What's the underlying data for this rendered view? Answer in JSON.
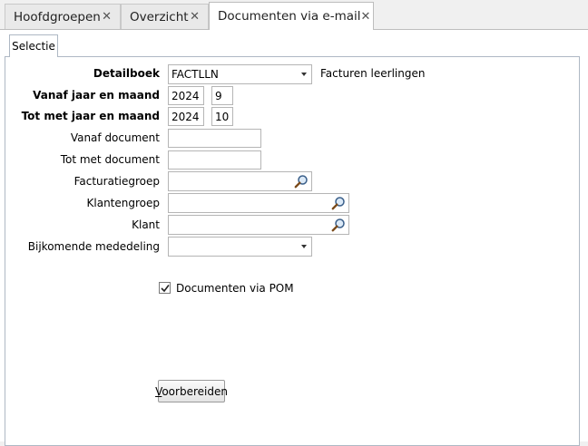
{
  "tabs": [
    {
      "label": "Hoofdgroepen",
      "close": "✕"
    },
    {
      "label": "Overzicht",
      "close": "✕"
    },
    {
      "label": "Documenten via e-mail",
      "close": "✕"
    }
  ],
  "subtab": {
    "label": "Selectie"
  },
  "form": {
    "detailboek": {
      "label": "Detailboek",
      "value": "FACTLLN",
      "description": "Facturen leerlingen"
    },
    "vanaf_jaar_maand": {
      "label": "Vanaf jaar en maand",
      "year": "2024",
      "month": "9"
    },
    "tot_jaar_maand": {
      "label": "Tot met jaar en maand",
      "year": "2024",
      "month": "10"
    },
    "vanaf_document": {
      "label": "Vanaf document",
      "value": ""
    },
    "tot_document": {
      "label": "Tot met document",
      "value": ""
    },
    "facturatiegroep": {
      "label": "Facturatiegroep",
      "value": ""
    },
    "klantengroep": {
      "label": "Klantengroep",
      "value": ""
    },
    "klant": {
      "label": "Klant",
      "value": ""
    },
    "bijkomende_mededeling": {
      "label": "Bijkomende mededeling",
      "value": ""
    },
    "documenten_via_pom": {
      "label": "Documenten via POM",
      "checked": true
    }
  },
  "actions": {
    "prepare_label": "Voorbereiden"
  }
}
